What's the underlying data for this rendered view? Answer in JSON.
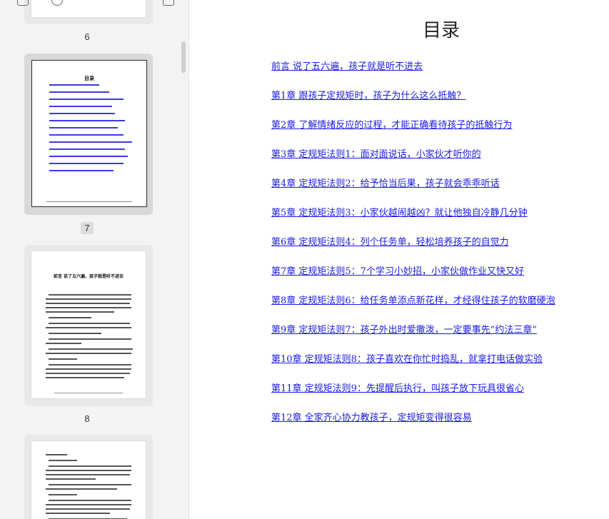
{
  "sidebar": {
    "thumbnails": [
      {
        "page_label": "6"
      },
      {
        "page_label": "7",
        "selected": true
      },
      {
        "page_label": "8"
      }
    ],
    "mini_toc_title": "目录",
    "mini_page8_heading": "前言 说了五六遍，孩子就是听不进去"
  },
  "document": {
    "title": "目录",
    "toc": [
      "前言 说了五六遍，孩子就是听不进去",
      "第1章 跟孩子定规矩时，孩子为什么这么抵触？",
      "第2章 了解情绪反应的过程，才能正确看待孩子的抵触行为",
      "第3章 定规矩法则1：面对面说话，小家伙才听你的",
      "第4章 定规矩法则2：给予恰当后果，孩子就会乖乖听话",
      "第5章 定规矩法则3：小家伙越闹越凶？就让他独自冷静几分钟",
      "第6章 定规矩法则4：列个任务单，轻松培养孩子的自觉力",
      "第7章 定规矩法则5：7个学习小妙招，小家伙做作业又快又好",
      "第8章 定规矩法则6：给任务单添点新花样，才经得住孩子的软磨硬泡",
      "第9章 定规矩法则7：孩子外出时爱撒泼，一定要事先“约法三章”",
      "第10章 定规矩法则8：孩子喜欢在你忙时捣乱，就拿打电话做实验",
      "第11章 定规矩法则9：先提醒后执行，叫孩子放下玩具很省心",
      "第12章 全家齐心协力教孩子，定规矩变得很容易"
    ]
  },
  "colors": {
    "link": "#1a1ae6",
    "sidebar_bg": "#f3f3f3"
  }
}
